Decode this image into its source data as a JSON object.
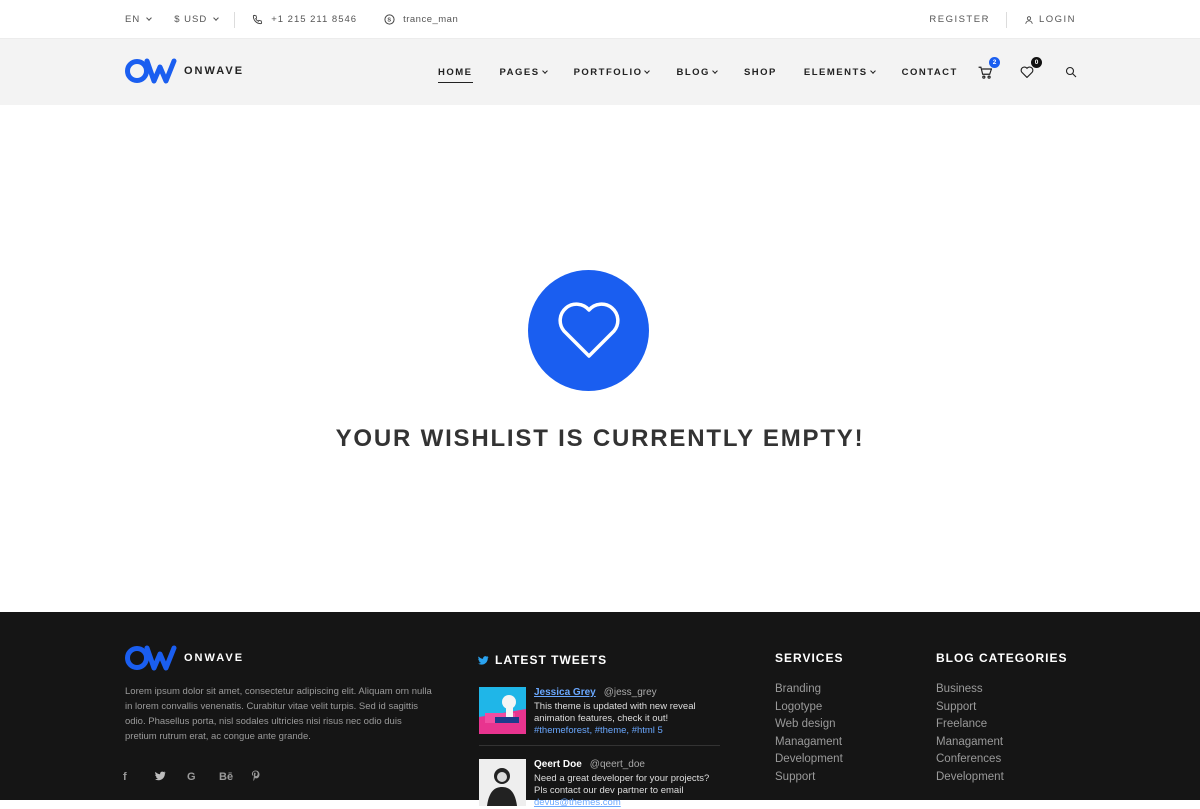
{
  "topbar": {
    "language": "EN",
    "currency": "$ USD",
    "phone": "+1 215 211 8546",
    "skype": "trance_man",
    "register": "REGISTER",
    "login": "LOGIN"
  },
  "brand": {
    "name": "ONWAVE",
    "color": "#1a5ef0"
  },
  "nav": {
    "items": [
      {
        "label": "HOME",
        "dropdown": false,
        "active": true
      },
      {
        "label": "PAGES",
        "dropdown": true
      },
      {
        "label": "PORTFOLIO",
        "dropdown": true
      },
      {
        "label": "BLOG",
        "dropdown": true
      },
      {
        "label": "SHOP",
        "dropdown": false
      },
      {
        "label": "ELEMENTS",
        "dropdown": true
      },
      {
        "label": "CONTACT",
        "dropdown": false
      }
    ],
    "cart_count": "2",
    "wishlist_count": "0",
    "cart_badge_color": "#1a5ef0",
    "wishlist_badge_color": "#111111"
  },
  "main": {
    "empty_message": "YOUR WISHLIST IS CURRENTLY EMPTY!",
    "circle_color": "#1a5ef0",
    "icon": "heart-icon"
  },
  "footer": {
    "about": "Lorem ipsum dolor sit amet, consectetur adipiscing elit. Aliquam orn nulla in lorem convallis venenatis. Curabitur vitae velit turpis. Sed id sagittis odio. Phasellus porta, nisl sodales ultricies nisi risus nec odio duis pretium rutrum erat, ac congue ante  grande.",
    "social": [
      "f",
      "twitter",
      "G",
      "Bē",
      "pinterest"
    ],
    "tweets_heading": "LATEST TWEETS",
    "tweets": [
      {
        "name": "Jessica Grey",
        "handle": "@jess_grey",
        "text": "This theme is updated with new reveal animation features, check it out!",
        "hashtags": "#themeforest, #theme, #html 5"
      },
      {
        "name": "Qeert Doe",
        "handle": "@qeert_doe",
        "text": "Need a great developer for your projects? Pls contact our dev partner to email",
        "email": "devus@themes.com"
      }
    ],
    "services_heading": "SERVICES",
    "services": [
      "Branding",
      "Logotype",
      "Web design",
      "Managament",
      "Development",
      "Support"
    ],
    "blog_heading": "BLOG CATEGORIES",
    "blog_categories": [
      "Business",
      "Support",
      "Freelance",
      "Managament",
      "Conferences",
      "Development"
    ]
  }
}
